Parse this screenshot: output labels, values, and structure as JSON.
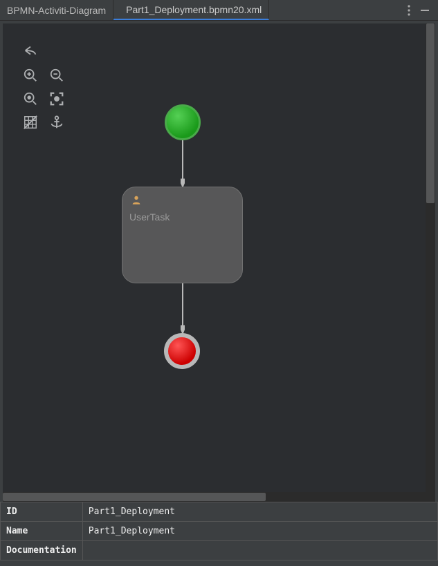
{
  "tabs": [
    {
      "label": "BPMN-Activiti-Diagram",
      "active": false
    },
    {
      "label": "Part1_Deployment.bpmn20.xml",
      "active": true
    }
  ],
  "diagram": {
    "task_label": "UserTask"
  },
  "properties": {
    "id_label": "ID",
    "id_value": "Part1_Deployment",
    "name_label": "Name",
    "name_value": "Part1_Deployment",
    "doc_label": "Documentation",
    "doc_value": ""
  }
}
